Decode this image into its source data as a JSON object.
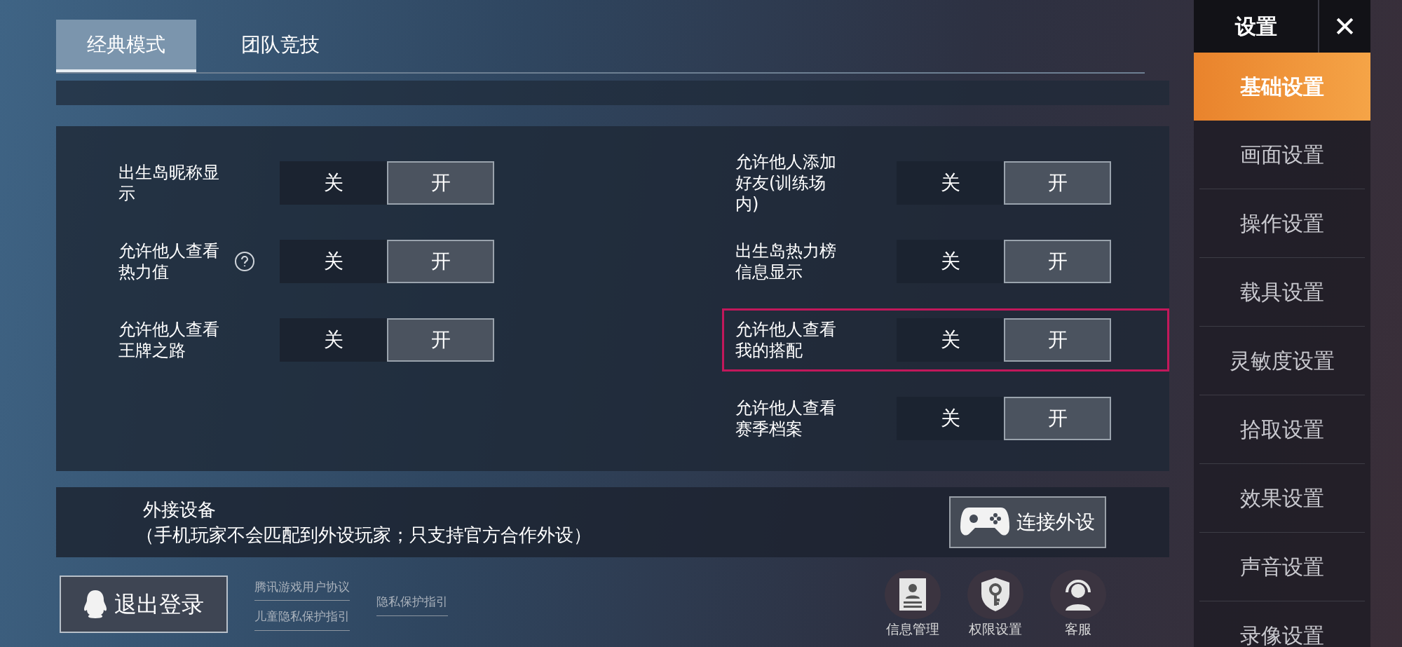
{
  "tabs": [
    {
      "label": "经典模式",
      "selected": true
    },
    {
      "label": "团队竞技",
      "selected": false
    }
  ],
  "settings_left": [
    {
      "label": "出生岛昵称显示",
      "help": false,
      "highlighted": false,
      "options": [
        {
          "label": "关",
          "selected": false
        },
        {
          "label": "开",
          "selected": true
        }
      ]
    },
    {
      "label": "允许他人查看热力值",
      "help": true,
      "highlighted": false,
      "options": [
        {
          "label": "关",
          "selected": false
        },
        {
          "label": "开",
          "selected": true
        }
      ]
    },
    {
      "label": "允许他人查看王牌之路",
      "help": false,
      "highlighted": false,
      "options": [
        {
          "label": "关",
          "selected": false
        },
        {
          "label": "开",
          "selected": true
        }
      ]
    }
  ],
  "settings_right": [
    {
      "label": "允许他人添加好友(训练场内)",
      "help": false,
      "highlighted": false,
      "options": [
        {
          "label": "关",
          "selected": false
        },
        {
          "label": "开",
          "selected": true
        }
      ]
    },
    {
      "label": "出生岛热力榜信息显示",
      "help": false,
      "highlighted": false,
      "options": [
        {
          "label": "关",
          "selected": false
        },
        {
          "label": "开",
          "selected": true
        }
      ]
    },
    {
      "label": "允许他人查看我的搭配",
      "help": false,
      "highlighted": true,
      "options": [
        {
          "label": "关",
          "selected": false
        },
        {
          "label": "开",
          "selected": true
        }
      ]
    },
    {
      "label": "允许他人查看赛季档案",
      "help": false,
      "highlighted": false,
      "options": [
        {
          "label": "关",
          "selected": false
        },
        {
          "label": "开",
          "selected": true
        }
      ]
    }
  ],
  "external_device": {
    "title": "外接设备",
    "note": "（手机玩家不会匹配到外设玩家；只支持官方合作外设）",
    "button": "连接外设"
  },
  "logout_button": "退出登录",
  "links": [
    [
      "腾讯游戏用户协议",
      "儿童隐私保护指引"
    ],
    [
      "隐私保护指引"
    ]
  ],
  "footer_buttons": [
    {
      "kind": "profile",
      "label": "信息管理"
    },
    {
      "kind": "permission",
      "label": "权限设置"
    },
    {
      "kind": "support",
      "label": "客服"
    }
  ],
  "sidebar": {
    "title": "设置",
    "close": "✕",
    "items": [
      {
        "label": "基础设置",
        "selected": true
      },
      {
        "label": "画面设置",
        "selected": false
      },
      {
        "label": "操作设置",
        "selected": false
      },
      {
        "label": "载具设置",
        "selected": false
      },
      {
        "label": "灵敏度设置",
        "selected": false
      },
      {
        "label": "拾取设置",
        "selected": false
      },
      {
        "label": "效果设置",
        "selected": false
      },
      {
        "label": "声音设置",
        "selected": false
      },
      {
        "label": "录像设置",
        "selected": false
      }
    ]
  }
}
